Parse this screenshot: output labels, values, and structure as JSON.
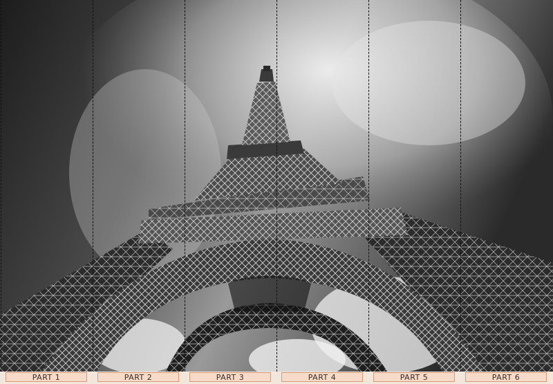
{
  "panels": [
    {
      "label": "PART 1"
    },
    {
      "label": "PART 2"
    },
    {
      "label": "PART 3"
    },
    {
      "label": "PART 4"
    },
    {
      "label": "PART 5"
    },
    {
      "label": "PART 6"
    }
  ]
}
